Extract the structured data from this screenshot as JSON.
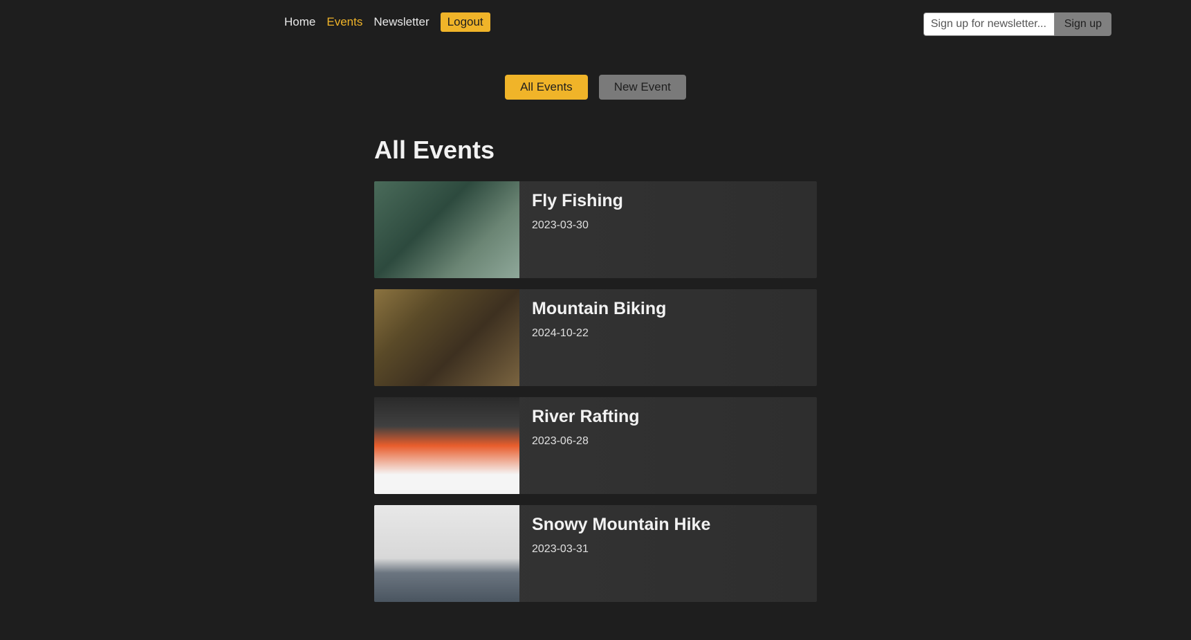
{
  "nav": {
    "home": "Home",
    "events": "Events",
    "newsletter": "Newsletter",
    "logout": "Logout"
  },
  "newsletter_form": {
    "placeholder": "Sign up for newsletter...",
    "button": "Sign up"
  },
  "tabs": {
    "all_events": "All Events",
    "new_event": "New Event"
  },
  "page_title": "All Events",
  "events": [
    {
      "title": "Fly Fishing",
      "date": "2023-03-30"
    },
    {
      "title": "Mountain Biking",
      "date": "2024-10-22"
    },
    {
      "title": "River Rafting",
      "date": "2023-06-28"
    },
    {
      "title": "Snowy Mountain Hike",
      "date": "2023-03-31"
    }
  ]
}
